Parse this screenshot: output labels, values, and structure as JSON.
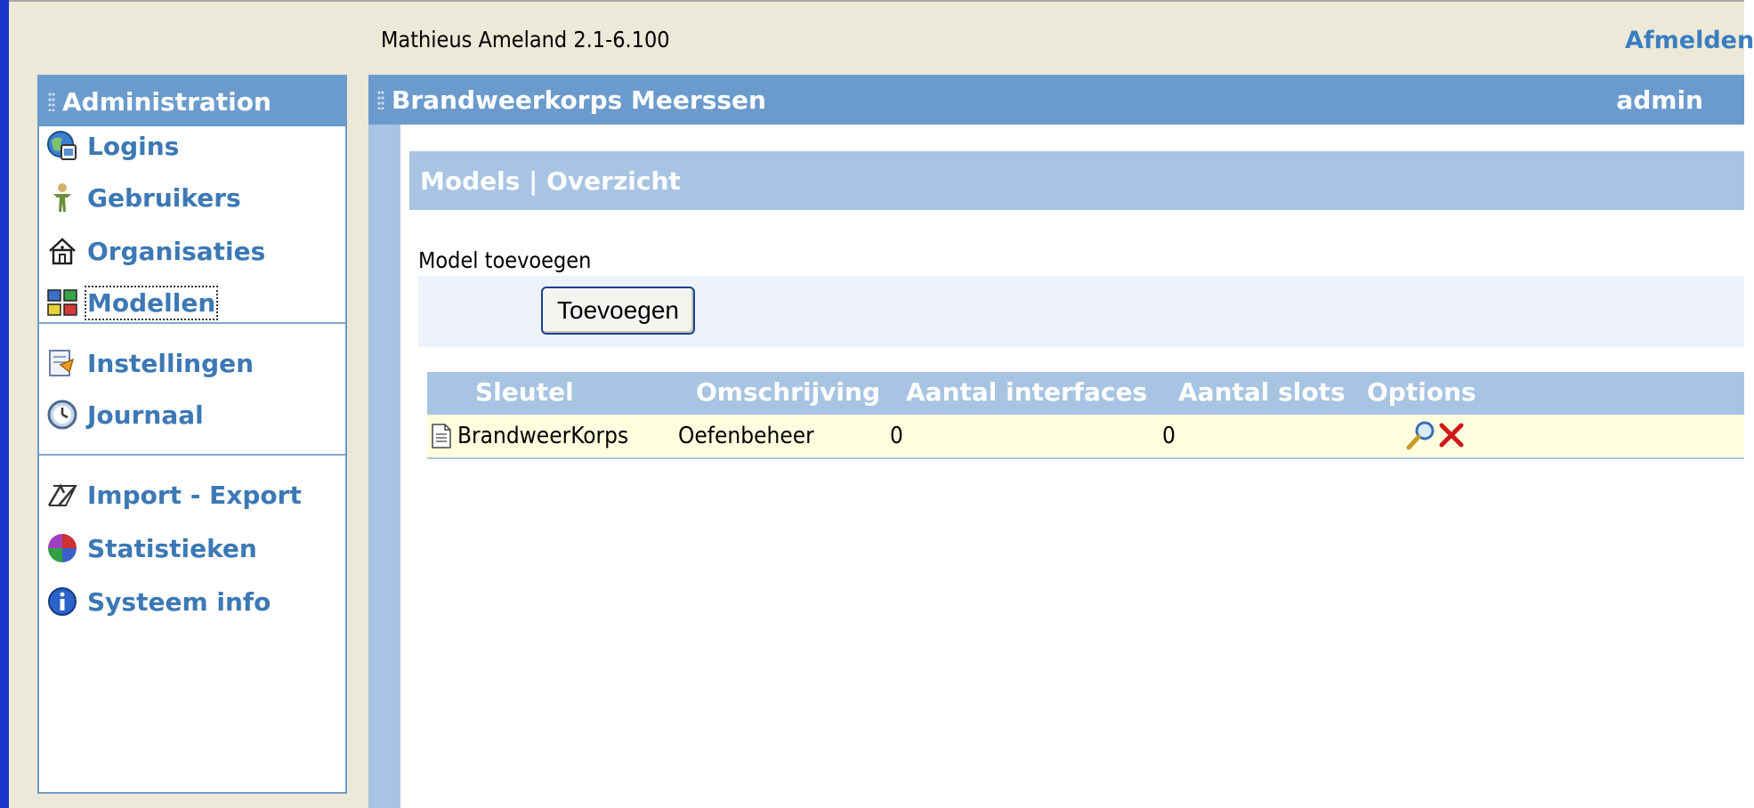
{
  "app": {
    "title": "Mathieus Ameland 2.1-6.100",
    "logout": "Afmelden"
  },
  "sidebar": {
    "title": "Administration",
    "items": [
      {
        "label": "Logins",
        "icon": "logins-icon"
      },
      {
        "label": "Gebruikers",
        "icon": "user-figure-icon"
      },
      {
        "label": "Organisaties",
        "icon": "house-icon"
      },
      {
        "label": "Modellen",
        "icon": "models-icon"
      },
      {
        "label": "Instellingen",
        "icon": "settings-icon"
      },
      {
        "label": "Journaal",
        "icon": "clock-icon"
      },
      {
        "label": "Import - Export",
        "icon": "import-export-icon"
      },
      {
        "label": "Statistieken",
        "icon": "statistics-icon"
      },
      {
        "label": "Systeem info",
        "icon": "info-icon"
      }
    ]
  },
  "main": {
    "title": "Brandweerkorps Meerssen",
    "user": "admin",
    "section_title": "Models | Overzicht",
    "add_label": "Model toevoegen",
    "add_button": "Toevoegen",
    "table": {
      "headers": [
        "Sleutel",
        "Omschrijving",
        "Aantal interfaces",
        "Aantal slots",
        "Options"
      ],
      "rows": [
        {
          "key": "BrandweerKorps",
          "description": "Oefenbeheer",
          "interfaces": "0",
          "slots": "0"
        }
      ]
    }
  },
  "colors": {
    "header": "#6b9bcd",
    "link": "#3c78b5",
    "row_highlight": "#ffffe0",
    "window_edge": "#1a33c8"
  }
}
